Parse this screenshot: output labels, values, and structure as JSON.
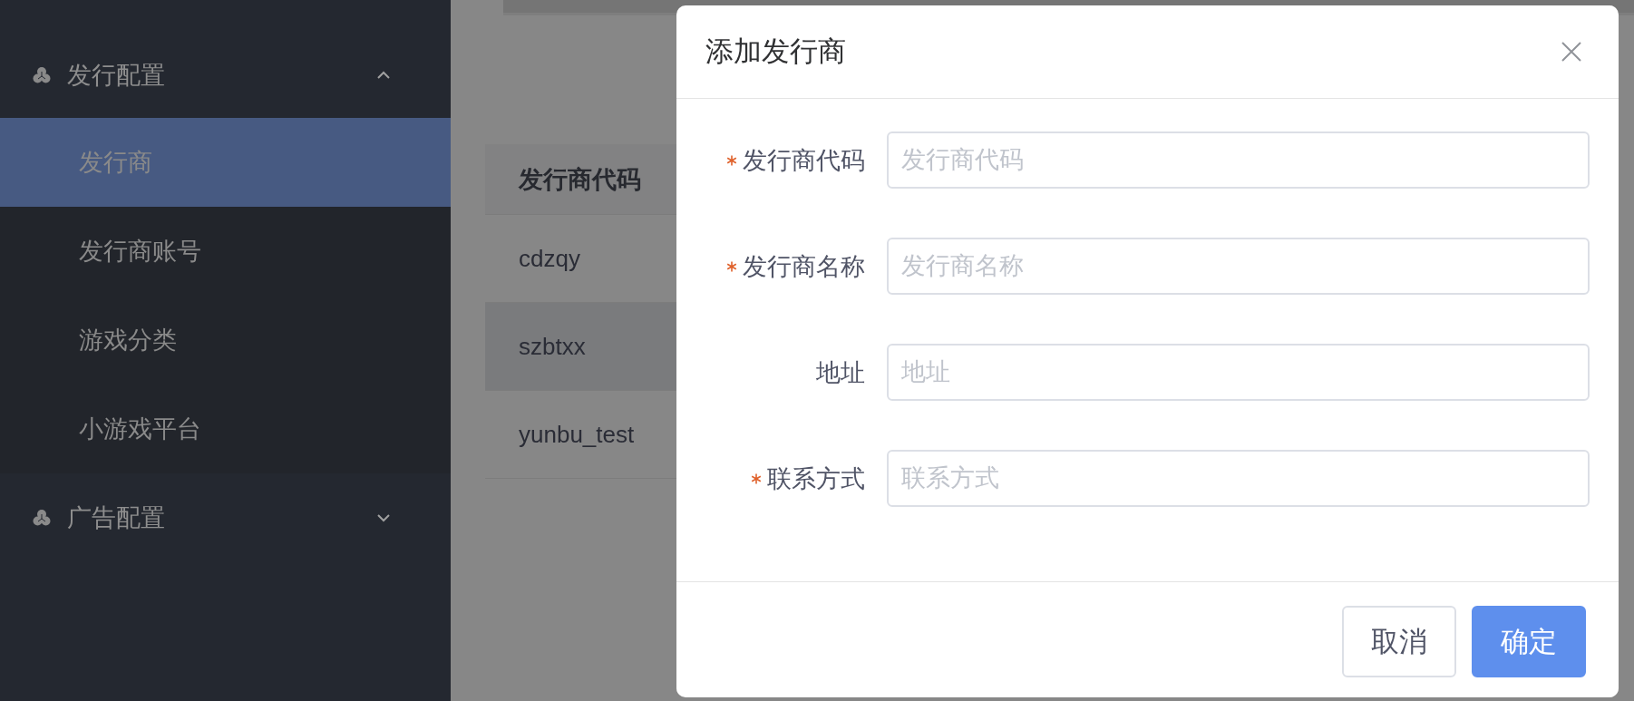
{
  "sidebar": {
    "groups": [
      {
        "label": "发行配置",
        "expanded": true,
        "children": [
          {
            "label": "发行商",
            "selected": true
          },
          {
            "label": "发行商账号",
            "selected": false
          },
          {
            "label": "游戏分类",
            "selected": false
          },
          {
            "label": "小游戏平台",
            "selected": false
          }
        ]
      },
      {
        "label": "广告配置",
        "expanded": false
      }
    ]
  },
  "table": {
    "columns": [
      "发行商代码"
    ],
    "rows": [
      {
        "cells": [
          "cdzqy"
        ],
        "highlighted": false
      },
      {
        "cells": [
          "szbtxx"
        ],
        "highlighted": true
      },
      {
        "cells": [
          "yunbu_test"
        ],
        "highlighted": false
      }
    ]
  },
  "dialog": {
    "title": "添加发行商",
    "fields": [
      {
        "label": "发行商代码",
        "placeholder": "发行商代码",
        "required": true
      },
      {
        "label": "发行商名称",
        "placeholder": "发行商名称",
        "required": true
      },
      {
        "label": "地址",
        "placeholder": "地址",
        "required": false
      },
      {
        "label": "联系方式",
        "placeholder": "联系方式",
        "required": true
      }
    ],
    "buttons": [
      {
        "label": "取消",
        "kind": "default"
      },
      {
        "label": "确定",
        "kind": "primary"
      }
    ]
  }
}
